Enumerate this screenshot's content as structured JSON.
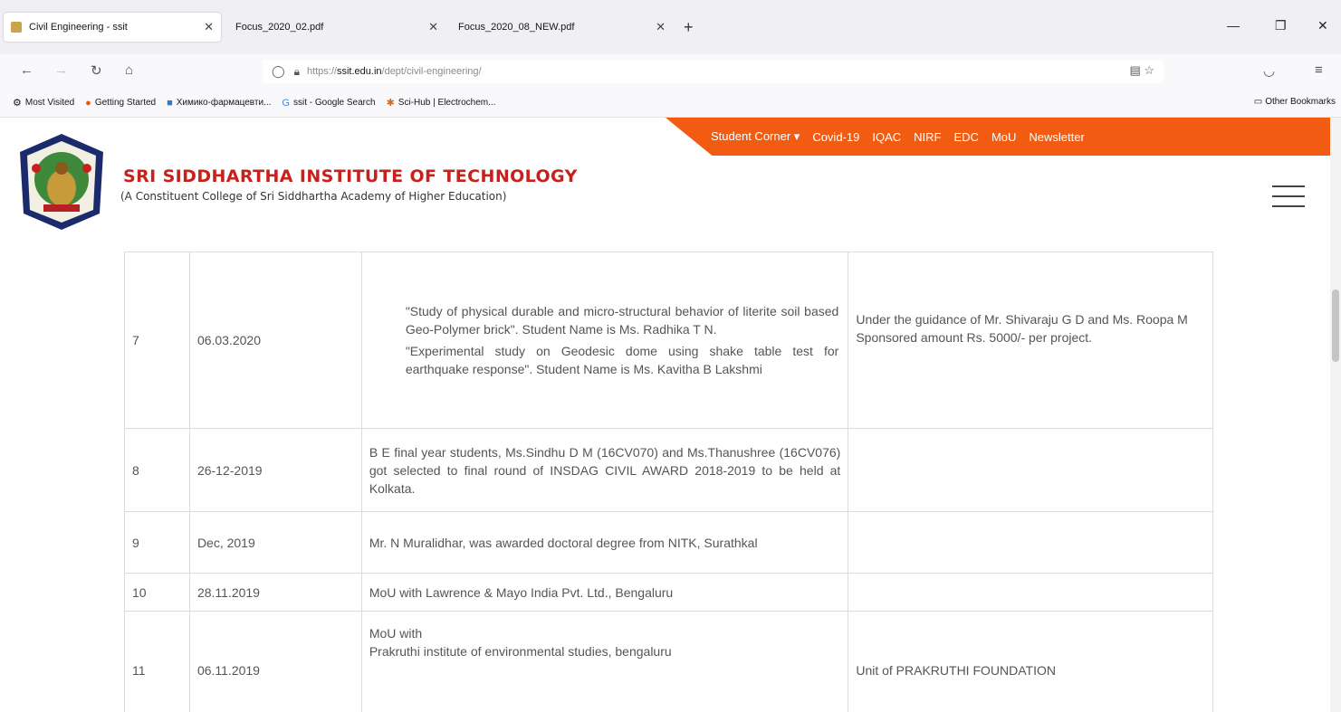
{
  "browser": {
    "tabs": [
      {
        "title": "Civil Engineering - ssit",
        "active": true,
        "favicon_color": "#caa44a"
      },
      {
        "title": "Focus_2020_02.pdf",
        "active": false
      },
      {
        "title": "Focus_2020_08_NEW.pdf",
        "active": false
      }
    ],
    "new_tab": "+",
    "window_controls": {
      "minimize": "—",
      "restore": "❐",
      "close": "✕"
    },
    "url": {
      "scheme": "https://",
      "host": "ssit.edu.in",
      "path": "/dept/civil-engineering/"
    },
    "bookmarks": [
      {
        "label": "Most Visited",
        "icon": "gear-icon"
      },
      {
        "label": "Getting Started",
        "icon": "firefox-icon"
      },
      {
        "label": "Химико-фармацевти...",
        "icon": "bookmark-icon"
      },
      {
        "label": "ssit - Google Search",
        "icon": "google-icon"
      },
      {
        "label": "Sci-Hub | Electrochem...",
        "icon": "scihub-icon"
      }
    ],
    "other_bookmarks": "Other Bookmarks"
  },
  "site": {
    "topnav": [
      "Student Corner ▾",
      "Covid-19",
      "IQAC",
      "NIRF",
      "EDC",
      "MoU",
      "Newsletter"
    ],
    "institute_name": "SRI SIDDHARTHA INSTITUTE OF TECHNOLOGY",
    "institute_sub": "(A Constituent College of Sri Siddhartha Academy of Higher Education)",
    "accent": "#f25b12",
    "title_color": "#c8201b"
  },
  "table": {
    "rows": [
      {
        "sno": "7",
        "date": "06.03.2020",
        "desc": [
          "\"Study of physical durable and micro-structural behavior of literite soil based Geo-Polymer brick\". Student Name is Ms. Radhika T N.",
          "\"Experimental study on Geodesic dome using shake table test for earthquake response\". Student Name is Ms. Kavitha B Lakshmi"
        ],
        "remarks": [
          "Under the guidance of Mr. Shivaraju G D and Ms. Roopa M",
          "Sponsored amount Rs. 5000/- per project."
        ]
      },
      {
        "sno": "8",
        "date": "26-12-2019",
        "desc": [
          "B E final year students, Ms.Sindhu D M (16CV070) and Ms.Thanushree (16CV076) got selected to final round of INSDAG CIVIL AWARD 2018-2019 to be held at Kolkata."
        ],
        "remarks": []
      },
      {
        "sno": "9",
        "date": "Dec, 2019",
        "desc": [
          "Mr. N Muralidhar, was awarded doctoral degree from NITK, Surathkal"
        ],
        "remarks": []
      },
      {
        "sno": "10",
        "date": "28.11.2019",
        "desc": [
          "MoU with Lawrence & Mayo India Pvt. Ltd., Bengaluru"
        ],
        "remarks": []
      },
      {
        "sno": "11",
        "date": "06.11.2019",
        "desc": [
          "MoU with",
          "Prakruthi institute of environmental studies, bengaluru"
        ],
        "remarks": [
          "Unit of PRAKRUTHI FOUNDATION"
        ]
      }
    ]
  }
}
